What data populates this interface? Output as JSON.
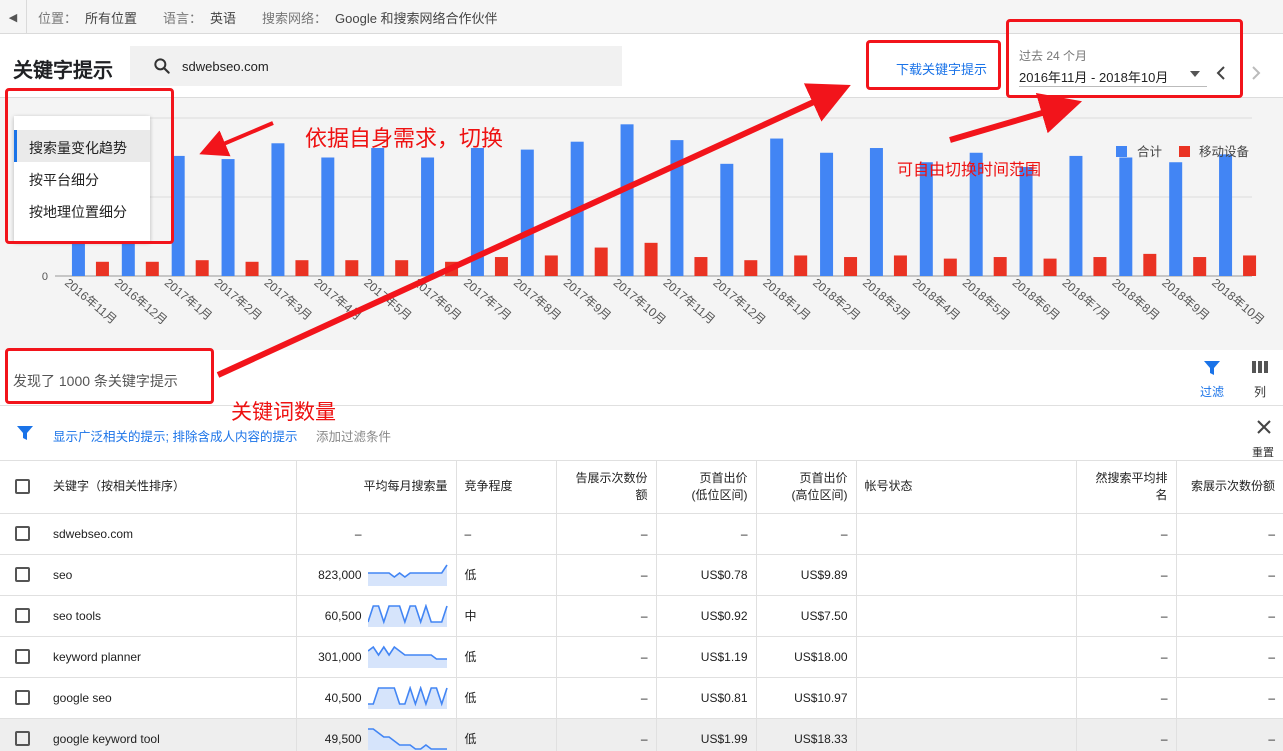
{
  "topbar": {
    "location_label": "位置：",
    "location_value": "所有位置",
    "language_label": "语言：",
    "language_value": "英语",
    "network_label": "搜索网络：",
    "network_value": "Google 和搜索网络合作伙伴"
  },
  "header": {
    "title": "关键字提示",
    "search_value": "sdwebseo.com",
    "download_label": "下载关键字提示",
    "date_caption": "过去 24 个月",
    "date_value": "2016年11月 - 2018年10月"
  },
  "menu": {
    "items": [
      {
        "label": "搜索量变化趋势"
      },
      {
        "label": "按平台细分"
      },
      {
        "label": "按地理位置细分"
      }
    ]
  },
  "chart_data": {
    "type": "bar",
    "categories": [
      "2016年11月",
      "2016年12月",
      "2017年1月",
      "2017年2月",
      "2017年3月",
      "2017年4月",
      "2017年5月",
      "2017年6月",
      "2017年7月",
      "2017年8月",
      "2017年9月",
      "2017年10月",
      "2017年11月",
      "2017年12月",
      "2018年1月",
      "2018年2月",
      "2018年3月",
      "2018年4月",
      "2018年5月",
      "2018年6月",
      "2018年7月",
      "2018年8月",
      "2018年9月",
      "2018年10月"
    ],
    "series": [
      {
        "name": "合计",
        "color": "#4285f4",
        "values": [
          68,
          72,
          76,
          74,
          84,
          75,
          81,
          75,
          81,
          80,
          85,
          96,
          86,
          71,
          87,
          78,
          81,
          72,
          78,
          69,
          76,
          75,
          72,
          77
        ]
      },
      {
        "name": "移动设备",
        "color": "#ea3323",
        "values": [
          9,
          9,
          10,
          9,
          10,
          10,
          10,
          9,
          12,
          13,
          18,
          21,
          12,
          10,
          13,
          12,
          13,
          11,
          12,
          11,
          12,
          14,
          12,
          13
        ]
      }
    ],
    "y_ticks": [
      "0"
    ],
    "ylim": [
      0,
      100
    ],
    "grid": true,
    "legend": "top-right"
  },
  "results": {
    "count_text": "发现了 1000 条关键字提示",
    "filter_label": "过滤",
    "columns_label": "列"
  },
  "filters": {
    "text": "显示广泛相关的提示; 排除含成人内容的提示",
    "add_label": "添加过滤条件",
    "reset_label": "重置"
  },
  "table": {
    "headers": [
      "关键字（按相关性排序）",
      "平均每月搜索量",
      "竞争程度",
      "告展示次数份额",
      "页首出价\n(低位区间)",
      "页首出价\n(高位区间)",
      "帐号状态",
      "然搜索平均排名",
      "索展示次数份额"
    ],
    "rows": [
      {
        "keyword": "sdwebseo.com",
        "volume": "–",
        "competition": "–",
        "share": "–",
        "low": "–",
        "high": "–",
        "status": "",
        "rank": "–",
        "impr": "–",
        "trend": []
      },
      {
        "keyword": "seo",
        "volume": "823,000",
        "competition": "低",
        "share": "–",
        "low": "US$0.78",
        "high": "US$9.89",
        "status": "",
        "rank": "–",
        "impr": "–",
        "trend": [
          3,
          3,
          3,
          3,
          3,
          2,
          3,
          2,
          3,
          3,
          3,
          3,
          3,
          3,
          3,
          5
        ]
      },
      {
        "keyword": "seo tools",
        "volume": "60,500",
        "competition": "中",
        "share": "–",
        "low": "US$0.92",
        "high": "US$7.50",
        "status": "",
        "rank": "–",
        "impr": "–",
        "trend": [
          1,
          5,
          5,
          1,
          5,
          5,
          5,
          1,
          5,
          5,
          1,
          5,
          1,
          1,
          1,
          5
        ]
      },
      {
        "keyword": "keyword planner",
        "volume": "301,000",
        "competition": "低",
        "share": "–",
        "low": "US$1.19",
        "high": "US$18.00",
        "status": "",
        "rank": "–",
        "impr": "–",
        "trend": [
          4,
          5,
          3,
          5,
          3,
          5,
          4,
          3,
          3,
          3,
          3,
          3,
          3,
          2,
          2,
          2
        ]
      },
      {
        "keyword": "google seo",
        "volume": "40,500",
        "competition": "低",
        "share": "–",
        "low": "US$0.81",
        "high": "US$10.97",
        "status": "",
        "rank": "–",
        "impr": "–",
        "trend": [
          1,
          1,
          5,
          5,
          5,
          5,
          1,
          1,
          5,
          1,
          5,
          1,
          5,
          5,
          1,
          5
        ]
      },
      {
        "keyword": "google keyword tool",
        "volume": "49,500",
        "competition": "低",
        "share": "–",
        "low": "US$1.99",
        "high": "US$18.33",
        "status": "",
        "rank": "–",
        "impr": "–",
        "trend": [
          5,
          5,
          4,
          3,
          3,
          2,
          1,
          1,
          1,
          0,
          0,
          1,
          0,
          0,
          0,
          0
        ]
      }
    ]
  },
  "annotations": {
    "switch_note": "依据自身需求，切换",
    "time_note": "可自由切换时间范围",
    "count_note": "关键词数量"
  }
}
